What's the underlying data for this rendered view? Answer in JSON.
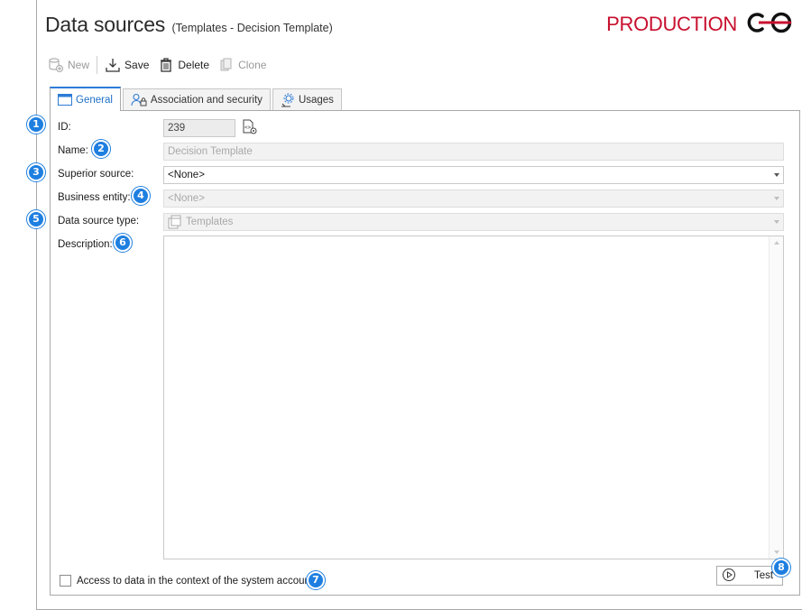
{
  "header": {
    "title": "Data sources",
    "subtitle": "(Templates - Decision Template)",
    "environment": "PRODUCTION",
    "env_color": "#c8102e"
  },
  "toolbar": {
    "new_label": "New",
    "save_label": "Save",
    "delete_label": "Delete",
    "clone_label": "Clone"
  },
  "tabs": [
    {
      "label": "General",
      "icon": "window-icon",
      "active": true
    },
    {
      "label": "Association and security",
      "icon": "user-lock-icon",
      "active": false
    },
    {
      "label": "Usages",
      "icon": "gear-usage-icon",
      "active": false
    }
  ],
  "form": {
    "id_label": "ID:",
    "id_value": "239",
    "name_label": "Name:",
    "name_value": "Decision Template",
    "superior_label": "Superior source:",
    "superior_value": "<None>",
    "business_label": "Business entity:",
    "business_value": "<None>",
    "type_label": "Data source type:",
    "type_value": "Templates",
    "description_label": "Description:",
    "description_value": "",
    "system_account_label": "Access to data in the context of the system account",
    "system_account_checked": false,
    "test_label": "Test"
  },
  "badges": [
    "1",
    "2",
    "3",
    "4",
    "5",
    "6",
    "7",
    "8"
  ],
  "accent_color": "#1e7fe0"
}
